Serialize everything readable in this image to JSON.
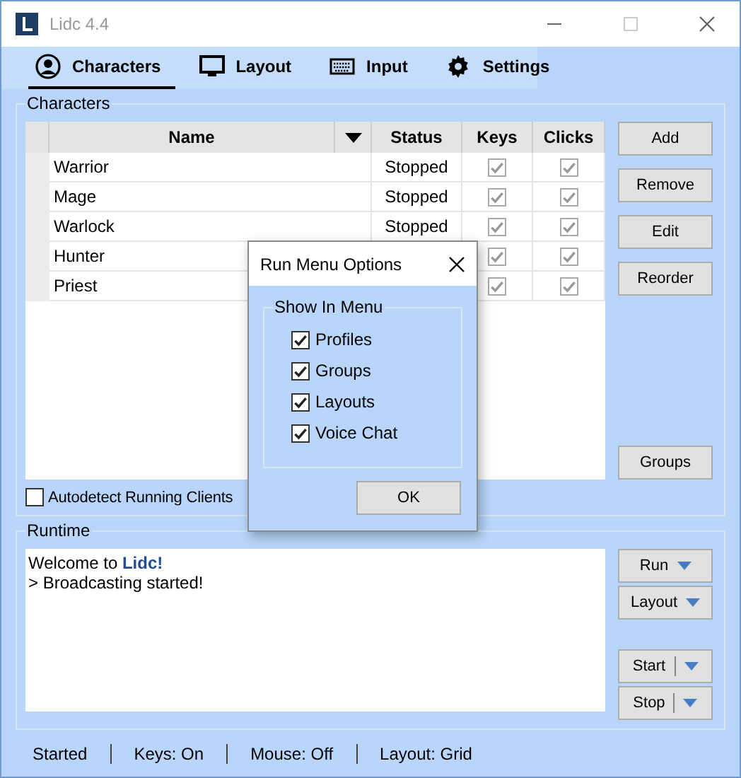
{
  "window": {
    "title": "Lidc 4.4"
  },
  "tabs": [
    {
      "label": "Characters",
      "selected": true
    },
    {
      "label": "Layout",
      "selected": false
    },
    {
      "label": "Input",
      "selected": false
    },
    {
      "label": "Settings",
      "selected": false
    }
  ],
  "characters": {
    "title": "Characters",
    "columns": [
      "Name",
      "Status",
      "Keys",
      "Clicks"
    ],
    "rows": [
      {
        "name": "Warrior",
        "status": "Stopped",
        "keys": true,
        "clicks": true
      },
      {
        "name": "Mage",
        "status": "Stopped",
        "keys": true,
        "clicks": true
      },
      {
        "name": "Warlock",
        "status": "Stopped",
        "keys": true,
        "clicks": true
      },
      {
        "name": "Hunter",
        "keys": true,
        "clicks": true
      },
      {
        "name": "Priest",
        "keys": true,
        "clicks": true
      }
    ],
    "buttons": [
      "Add",
      "Remove",
      "Edit",
      "Reorder"
    ],
    "groups_button": "Groups",
    "autodetect": {
      "label": "Autodetect Running Clients",
      "checked": false
    }
  },
  "runtime": {
    "title": "Runtime",
    "log": [
      "Welcome to **Lidc!**",
      "> Broadcasting started!"
    ],
    "buttons": [
      {
        "label": "Run",
        "kind": "dropdown"
      },
      {
        "label": "Layout",
        "kind": "dropdown"
      },
      {
        "label": "Start",
        "kind": "split"
      },
      {
        "label": "Stop",
        "kind": "split"
      }
    ]
  },
  "status_bar": [
    "Started",
    "Keys: On",
    "Mouse: Off",
    "Layout: Grid"
  ],
  "dialog": {
    "title": "Run Menu Options",
    "group": "Show In Menu",
    "options": [
      {
        "label": "Profiles",
        "checked": true
      },
      {
        "label": "Groups",
        "checked": true
      },
      {
        "label": "Layouts",
        "checked": true
      },
      {
        "label": "Voice Chat",
        "checked": true
      }
    ],
    "ok": "OK"
  }
}
